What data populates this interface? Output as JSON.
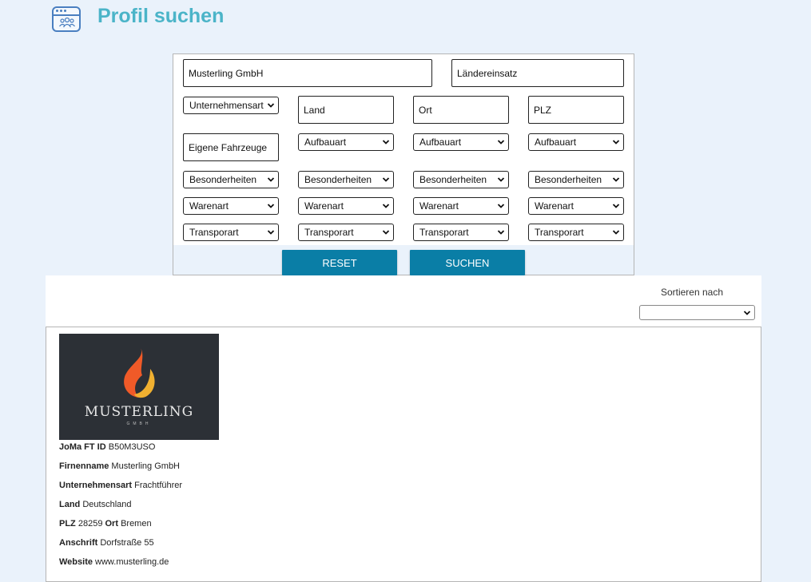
{
  "header": {
    "title": "Profil suchen",
    "icon": "team-window-icon",
    "accent_color": "#4bb4c8"
  },
  "search": {
    "company_name": "Musterling GmbH",
    "countries_placeholder": "Ländereinsatz",
    "company_type": "Unternehmensart",
    "country_placeholder": "Land",
    "city_placeholder": "Ort",
    "zip_placeholder": "PLZ",
    "own_vehicles_placeholder": "Eigene Fahrzeuge",
    "body_type": [
      "Aufbauart",
      "Aufbauart",
      "Aufbauart"
    ],
    "features": [
      "Besonderheiten",
      "Besonderheiten",
      "Besonderheiten",
      "Besonderheiten"
    ],
    "goods_type": [
      "Warenart",
      "Warenart",
      "Warenart",
      "Warenart"
    ],
    "transport_type": [
      "Transporart",
      "Transporart",
      "Transporart",
      "Transporart"
    ],
    "reset_label": "RESET",
    "search_label": "SUCHEN",
    "button_color": "#0a7ea6"
  },
  "sort": {
    "label": "Sortieren nach",
    "selected": ""
  },
  "result": {
    "logo_name": "MUSTERLING",
    "logo_sub": "GMBH",
    "fields": [
      {
        "label": "JoMa FT ID",
        "value": "B50M3USO"
      },
      {
        "label": "Firnenname",
        "value": "Musterling GmbH"
      },
      {
        "label": "Unternehmensart",
        "value": "Frachtführer"
      },
      {
        "label": "Land",
        "value": "Deutschland"
      },
      {
        "label": "PLZ",
        "value": "28259",
        "label2": "Ort",
        "value2": "Bremen"
      },
      {
        "label": "Anschrift",
        "value": "Dorfstraße 55"
      },
      {
        "label": "Website",
        "value": "www.musterling.de"
      }
    ]
  }
}
